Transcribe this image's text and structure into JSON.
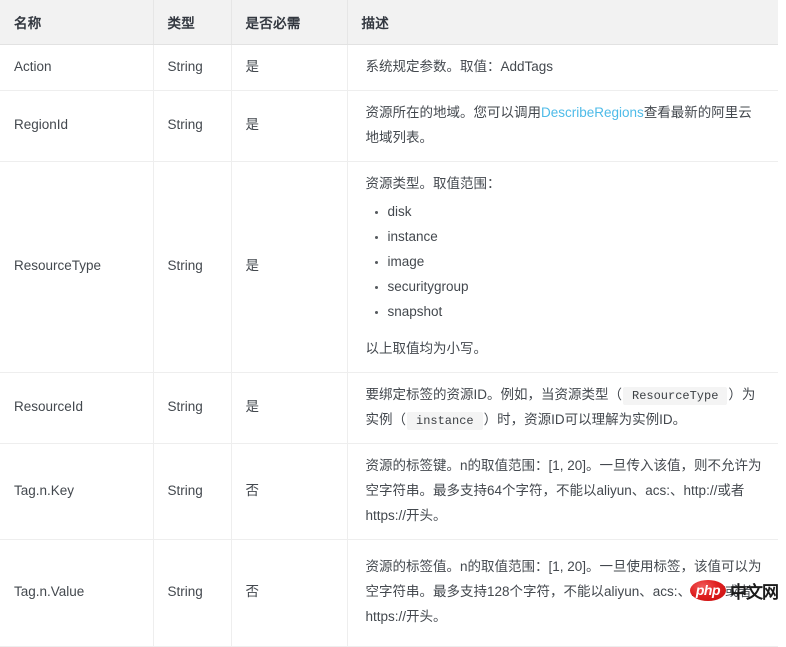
{
  "table": {
    "headers": [
      "名称",
      "类型",
      "是否必需",
      "描述"
    ],
    "rows": [
      {
        "name": "Action",
        "type": "String",
        "required": "是",
        "desc_text": "系统规定参数。取值：AddTags"
      },
      {
        "name": "RegionId",
        "type": "String",
        "required": "是",
        "desc_prefix": "资源所在的地域。您可以调用",
        "desc_link": "DescribeRegions",
        "desc_suffix": "查看最新的阿里云地域列表。"
      },
      {
        "name": "ResourceType",
        "type": "String",
        "required": "是",
        "desc_intro": "资源类型。取值范围：",
        "desc_items": [
          "disk",
          "instance",
          "image",
          "securitygroup",
          "snapshot"
        ],
        "desc_outro": "以上取值均为小写。"
      },
      {
        "name": "ResourceId",
        "type": "String",
        "required": "是",
        "desc_seg1": "要绑定标签的资源ID。例如，当资源类型（",
        "desc_code1": "ResourceType",
        "desc_seg2": "）为实例（",
        "desc_code2": "instance",
        "desc_seg3": "）时，资源ID可以理解为实例ID。"
      },
      {
        "name": "Tag.n.Key",
        "type": "String",
        "required": "否",
        "desc_text": "资源的标签键。n的取值范围：[1, 20]。一旦传入该值，则不允许为空字符串。最多支持64个字符，不能以aliyun、acs:、http://或者https://开头。"
      },
      {
        "name": "Tag.n.Value",
        "type": "String",
        "required": "否",
        "desc_text": "资源的标签值。n的取值范围：[1, 20]。一旦使用标签，该值可以为空字符串。最多支持128个字符，不能以aliyun、acs:、http://或者https://开头。"
      }
    ]
  },
  "watermark": {
    "badge": "php",
    "text": "中文网"
  },
  "colors": {
    "header_bg": "#f2f2f2",
    "link": "#4ebbe8",
    "text": "#43484e",
    "border": "#eeeeee",
    "code_bg": "#f4f4f4",
    "watermark_red": "#e02020"
  }
}
